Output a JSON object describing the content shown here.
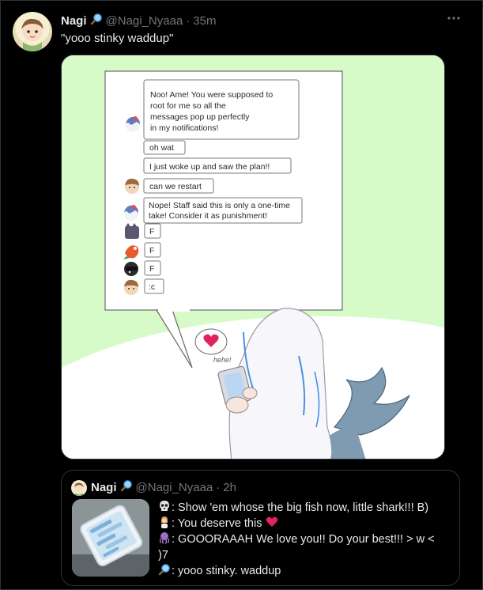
{
  "tweet": {
    "author_name": "Nagi",
    "author_handle": "@Nagi_Nyaaa",
    "separator": "·",
    "time": "35m",
    "text": "\"yooo stinky waddup\""
  },
  "comic": {
    "messages": [
      {
        "text_lines": [
          "Noo! Ame! You were supposed to",
          "root for me so all the",
          "messages pop up perfectly",
          "in my notifications!"
        ]
      },
      {
        "text_lines": [
          "oh wat"
        ]
      },
      {
        "text_lines": [
          "I just woke up and saw the plan!!"
        ]
      },
      {
        "text_lines": [
          "can we restart"
        ]
      },
      {
        "text_lines": [
          "Nope! Staff said this is only a one-time",
          "take! Consider it as punishment!"
        ]
      },
      {
        "text_lines": [
          "F"
        ]
      },
      {
        "text_lines": [
          "F"
        ]
      },
      {
        "text_lines": [
          "F"
        ]
      },
      {
        "text_lines": [
          ":c"
        ]
      }
    ],
    "sfx": "hehe!"
  },
  "quote": {
    "author_name": "Nagi",
    "author_handle": "@Nagi_Nyaaa",
    "separator": "·",
    "time": "2h",
    "lines": [
      {
        "emoji": "skull",
        "text": ": Show 'em whose the big fish now, little shark!!! B)"
      },
      {
        "emoji": "person",
        "text": ": You deserve this",
        "suffix_emoji": "red-heart"
      },
      {
        "emoji": "octopus",
        "text": ": GOOORAAAH We love you!! Do your best!!! > w <"
      },
      {
        "emoji": null,
        "text": ")7"
      },
      {
        "emoji": "magnifier",
        "text": ": yooo stinky. waddup"
      }
    ]
  },
  "icons": {
    "more": "more-horizontal-icon",
    "badge": "magnifying-glass-icon"
  },
  "colors": {
    "background": "#000000",
    "text": "#e7e9ea",
    "muted": "#71767b",
    "border": "#2f3336",
    "comic_bg": "#d6fbc8",
    "heart": "#e0245e"
  }
}
